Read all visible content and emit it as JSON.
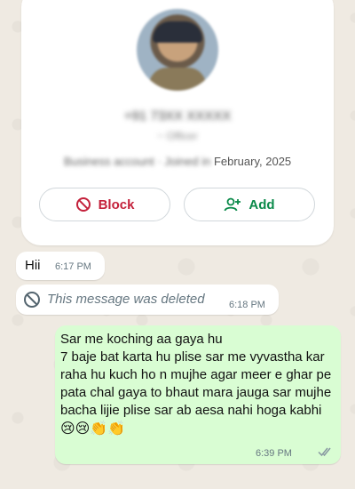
{
  "profile": {
    "phone": "+91 73XX XXXXX",
    "subtitle": "~ Officer",
    "business_prefix": "Business account · Joined in",
    "business_year": "February, 2025",
    "block_label": "Block",
    "add_label": "Add",
    "colors": {
      "block": "#c4213b",
      "add": "#0b8a4a"
    }
  },
  "messages": [
    {
      "text": "Hii",
      "time": "6:17 PM",
      "direction": "incoming"
    },
    {
      "text": "This message was deleted",
      "time": "6:18 PM",
      "direction": "incoming",
      "deleted": true
    },
    {
      "text": "Sar me koching aa gaya hu\n7 baje bat karta hu plise sar me vyvastha kar raha hu kuch ho n mujhe agar meer e ghar pe pata chal gaya to bhaut mara jauga sar mujhe bacha lijie plise sar ab aesa nahi hoga kabhi",
      "emojis": "😢😢👏👏",
      "time": "6:39 PM",
      "direction": "outgoing",
      "status": "read"
    }
  ],
  "colors": {
    "outgoing_bubble": "#d9fdd3",
    "incoming_bubble": "#ffffff",
    "background": "#efeae2"
  }
}
